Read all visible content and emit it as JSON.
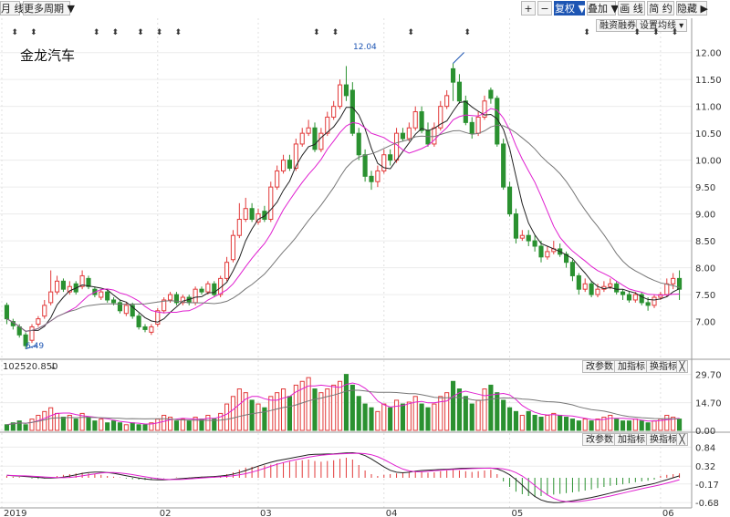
{
  "toolbar": {
    "month_line": "月 线",
    "multi_period": "更多周期 ▼",
    "plus": "+",
    "minus": "−",
    "restore_rights": "复权 ▼",
    "overlay": "叠加 ▼",
    "draw_line": "画 线",
    "simple": "简 约",
    "hide": "隐藏 ▶",
    "margin_trend": "融资融券",
    "ma_settings": "设置均线 ▾"
  },
  "stock_name": "金龙汽车",
  "price_high_label": "12.04",
  "price_low_label": "6.49",
  "volume_label": "102520.850",
  "volume_arrow": "↓",
  "indicator_buttons": [
    "改参数",
    "加指标",
    "换指标"
  ],
  "close_button": "╳",
  "colors": {
    "up": "#e23a3a",
    "down": "#2a9130",
    "ma5": "#222222",
    "ma10": "#e020d0",
    "ma20": "#777777",
    "accent": "#1d55b3"
  },
  "chart_data": {
    "type": "candlestick",
    "price_axis": {
      "ticks": [
        "12.00",
        "11.50",
        "11.00",
        "10.50",
        "10.00",
        "9.50",
        "9.00",
        "8.50",
        "8.00",
        "7.50",
        "7.00"
      ],
      "ylim": [
        6.45,
        12.3
      ]
    },
    "volume_axis": {
      "ticks": [
        "29.70",
        "14.70",
        "0.00"
      ],
      "ylim": [
        0,
        30
      ]
    },
    "macd_axis": {
      "ticks": [
        "0.84",
        "0.32",
        "-0.17",
        "-0.68"
      ],
      "ylim": [
        -0.7,
        0.9
      ]
    },
    "x_ticks": [
      {
        "label": "2019",
        "index": 0
      },
      {
        "label": "02",
        "index": 24
      },
      {
        "label": "03",
        "index": 40
      },
      {
        "label": "04",
        "index": 60
      },
      {
        "label": "05",
        "index": 80
      },
      {
        "label": "06",
        "index": 104
      }
    ],
    "closes": [
      7.05,
      6.92,
      6.75,
      6.55,
      6.9,
      7.05,
      7.3,
      7.55,
      7.75,
      7.6,
      7.65,
      7.55,
      7.85,
      7.65,
      7.5,
      7.55,
      7.4,
      7.35,
      7.2,
      7.3,
      7.1,
      6.9,
      6.85,
      6.9,
      7.2,
      7.4,
      7.5,
      7.35,
      7.45,
      7.35,
      7.6,
      7.55,
      7.7,
      7.5,
      7.8,
      8.1,
      8.6,
      8.9,
      9.1,
      8.9,
      9.0,
      8.9,
      9.5,
      9.8,
      10.0,
      9.85,
      10.3,
      10.5,
      10.6,
      10.2,
      10.5,
      10.8,
      11.0,
      11.4,
      11.2,
      10.5,
      10.1,
      9.7,
      9.6,
      9.8,
      10.1,
      10.0,
      10.5,
      10.4,
      10.6,
      10.9,
      10.55,
      10.3,
      10.6,
      11.0,
      11.2,
      11.45,
      11.1,
      10.7,
      10.5,
      10.8,
      11.1,
      11.15,
      10.3,
      9.5,
      9.0,
      8.55,
      8.6,
      8.5,
      8.4,
      8.2,
      8.3,
      8.35,
      8.25,
      8.1,
      7.85,
      7.6,
      7.7,
      7.5,
      7.6,
      7.65,
      7.7,
      7.55,
      7.5,
      7.4,
      7.5,
      7.35,
      7.3,
      7.45,
      7.5,
      7.7,
      7.8,
      7.6
    ],
    "opens": [
      7.3,
      7.0,
      6.9,
      6.75,
      6.65,
      6.95,
      7.1,
      7.35,
      7.55,
      7.75,
      7.55,
      7.7,
      7.65,
      7.8,
      7.6,
      7.45,
      7.55,
      7.4,
      7.35,
      7.15,
      7.3,
      7.1,
      6.9,
      6.8,
      6.95,
      7.2,
      7.4,
      7.5,
      7.35,
      7.45,
      7.35,
      7.6,
      7.55,
      7.7,
      7.5,
      7.8,
      8.15,
      8.6,
      8.9,
      9.1,
      8.85,
      9.05,
      8.9,
      9.5,
      9.8,
      10.0,
      9.85,
      10.3,
      10.5,
      10.6,
      10.2,
      10.5,
      10.8,
      11.0,
      11.4,
      11.3,
      10.5,
      10.1,
      9.7,
      9.6,
      9.8,
      10.1,
      10.0,
      10.5,
      10.4,
      10.6,
      10.9,
      10.55,
      10.3,
      10.6,
      11.0,
      11.7,
      11.45,
      11.1,
      10.7,
      10.5,
      10.8,
      11.3,
      11.15,
      10.3,
      9.5,
      9.0,
      8.55,
      8.6,
      8.5,
      8.4,
      8.2,
      8.3,
      8.35,
      8.25,
      8.1,
      7.85,
      7.6,
      7.7,
      7.5,
      7.6,
      7.65,
      7.7,
      7.55,
      7.5,
      7.4,
      7.5,
      7.35,
      7.3,
      7.45,
      7.5,
      7.7,
      7.8
    ],
    "highs": [
      7.35,
      7.05,
      6.95,
      6.8,
      6.95,
      7.1,
      7.4,
      7.95,
      7.85,
      7.8,
      7.75,
      7.75,
      7.95,
      7.85,
      7.65,
      7.6,
      7.6,
      7.45,
      7.4,
      7.35,
      7.35,
      7.15,
      6.95,
      6.95,
      7.25,
      7.45,
      7.55,
      7.55,
      7.5,
      7.5,
      7.65,
      7.65,
      7.75,
      7.75,
      7.85,
      8.2,
      8.7,
      9.2,
      9.3,
      9.2,
      9.1,
      9.15,
      9.6,
      9.9,
      10.1,
      10.1,
      10.4,
      10.6,
      10.75,
      10.7,
      10.6,
      10.9,
      11.1,
      11.5,
      11.75,
      11.45,
      10.6,
      10.2,
      9.8,
      9.9,
      10.2,
      10.2,
      10.6,
      10.6,
      10.7,
      11.0,
      11.0,
      10.7,
      10.7,
      11.1,
      11.3,
      11.8,
      11.6,
      11.2,
      10.8,
      10.9,
      11.2,
      11.35,
      11.2,
      10.4,
      9.6,
      9.1,
      8.7,
      8.7,
      8.6,
      8.5,
      8.4,
      8.5,
      8.45,
      8.3,
      8.15,
      7.9,
      7.8,
      7.75,
      7.7,
      7.75,
      7.8,
      7.75,
      7.6,
      7.55,
      7.55,
      7.55,
      7.45,
      7.5,
      7.55,
      7.8,
      7.9,
      7.95
    ],
    "lows": [
      6.95,
      6.85,
      6.7,
      6.49,
      6.6,
      6.9,
      7.05,
      7.3,
      7.5,
      7.55,
      7.5,
      7.5,
      7.6,
      7.6,
      7.45,
      7.4,
      7.35,
      7.3,
      7.15,
      7.1,
      7.05,
      6.85,
      6.8,
      6.75,
      6.9,
      7.15,
      7.35,
      7.3,
      7.3,
      7.3,
      7.3,
      7.5,
      7.5,
      7.45,
      7.45,
      7.75,
      8.1,
      8.55,
      8.85,
      8.85,
      8.8,
      8.85,
      8.85,
      9.45,
      9.75,
      9.8,
      9.8,
      10.25,
      10.45,
      10.15,
      10.15,
      10.45,
      10.75,
      10.95,
      11.1,
      10.45,
      10.0,
      9.6,
      9.45,
      9.5,
      9.75,
      9.9,
      9.95,
      10.35,
      10.35,
      10.55,
      10.5,
      10.25,
      10.25,
      10.55,
      10.95,
      11.1,
      11.05,
      10.65,
      10.4,
      10.45,
      10.75,
      11.05,
      10.25,
      9.45,
      8.95,
      8.45,
      8.5,
      8.4,
      8.3,
      8.1,
      8.15,
      8.25,
      8.2,
      8.0,
      7.75,
      7.5,
      7.55,
      7.45,
      7.45,
      7.55,
      7.6,
      7.5,
      7.4,
      7.35,
      7.35,
      7.3,
      7.2,
      7.25,
      7.4,
      7.45,
      7.6,
      7.4
    ],
    "volumes": [
      3,
      4,
      5,
      3,
      6,
      8,
      10,
      12,
      9,
      7,
      8,
      6,
      9,
      7,
      5,
      6,
      4,
      5,
      4,
      3,
      4,
      3,
      3,
      4,
      6,
      8,
      7,
      5,
      6,
      5,
      7,
      6,
      8,
      6,
      9,
      14,
      18,
      22,
      20,
      16,
      14,
      12,
      18,
      20,
      22,
      18,
      24,
      26,
      28,
      22,
      20,
      22,
      24,
      26,
      29.7,
      24,
      18,
      14,
      12,
      10,
      14,
      12,
      16,
      14,
      15,
      18,
      14,
      12,
      14,
      18,
      20,
      26,
      22,
      18,
      14,
      16,
      22,
      24,
      20,
      16,
      12,
      10,
      8,
      10,
      8,
      7,
      8,
      9,
      8,
      7,
      6,
      5,
      6,
      5,
      6,
      7,
      8,
      6,
      5,
      5,
      6,
      5,
      4,
      5,
      6,
      8,
      7,
      6
    ],
    "macd_hist": [
      0.05,
      0.03,
      0.02,
      0.0,
      -0.02,
      -0.03,
      -0.02,
      0.02,
      0.05,
      0.08,
      0.1,
      0.12,
      0.14,
      0.12,
      0.1,
      0.08,
      0.05,
      0.03,
      0.01,
      -0.02,
      -0.04,
      -0.05,
      -0.06,
      -0.05,
      -0.03,
      -0.01,
      0.0,
      0.01,
      0.0,
      0.01,
      0.02,
      0.03,
      0.04,
      0.05,
      0.06,
      0.1,
      0.15,
      0.22,
      0.28,
      0.3,
      0.32,
      0.34,
      0.36,
      0.4,
      0.42,
      0.44,
      0.46,
      0.48,
      0.5,
      0.46,
      0.44,
      0.46,
      0.48,
      0.52,
      0.55,
      0.5,
      0.35,
      0.2,
      0.1,
      0.05,
      0.08,
      0.1,
      0.12,
      0.14,
      0.16,
      0.18,
      0.16,
      0.14,
      0.15,
      0.18,
      0.2,
      0.22,
      0.2,
      0.18,
      0.16,
      0.18,
      0.2,
      0.22,
      0.1,
      -0.1,
      -0.25,
      -0.38,
      -0.45,
      -0.5,
      -0.52,
      -0.5,
      -0.48,
      -0.46,
      -0.44,
      -0.42,
      -0.4,
      -0.38,
      -0.35,
      -0.32,
      -0.28,
      -0.25,
      -0.22,
      -0.2,
      -0.18,
      -0.15,
      -0.12,
      -0.1,
      -0.08,
      -0.05,
      0.05,
      0.08,
      0.1,
      0.12
    ]
  }
}
